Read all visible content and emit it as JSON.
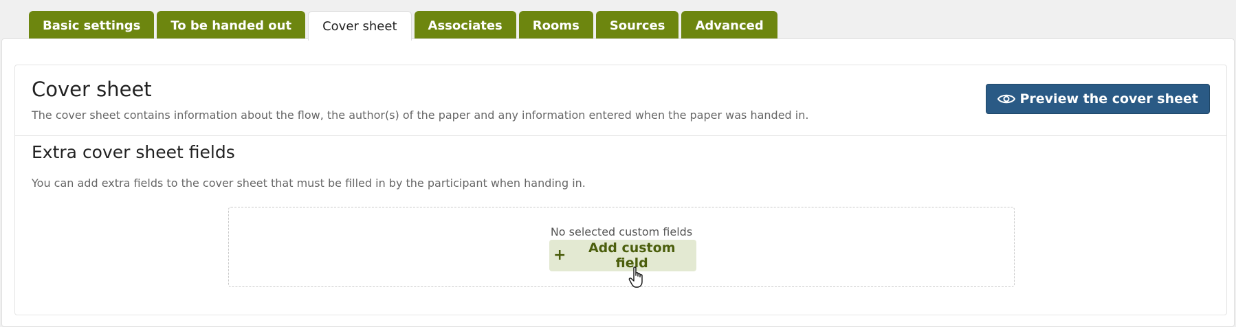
{
  "tabs": [
    {
      "label": "Basic settings",
      "active": false
    },
    {
      "label": "To be handed out",
      "active": false
    },
    {
      "label": "Cover sheet",
      "active": true
    },
    {
      "label": "Associates",
      "active": false
    },
    {
      "label": "Rooms",
      "active": false
    },
    {
      "label": "Sources",
      "active": false
    },
    {
      "label": "Advanced",
      "active": false
    }
  ],
  "cover": {
    "title": "Cover sheet",
    "description": "The cover sheet contains information about the flow, the author(s) of the paper and any information entered when the paper was handed in.",
    "preview_label": "Preview the cover sheet",
    "preview_icon": "eye-icon"
  },
  "extra": {
    "title": "Extra cover sheet fields",
    "description": "You can add extra fields to the cover sheet that must be filled in by the participant when handing in.",
    "empty_text": "No selected custom fields",
    "add_label": "Add custom field",
    "add_icon": "plus-icon"
  },
  "colors": {
    "tab_green": "#6d860f",
    "preview_blue": "#2a5a85",
    "add_bg": "#e3e9d2",
    "add_text": "#4b5e0c"
  }
}
